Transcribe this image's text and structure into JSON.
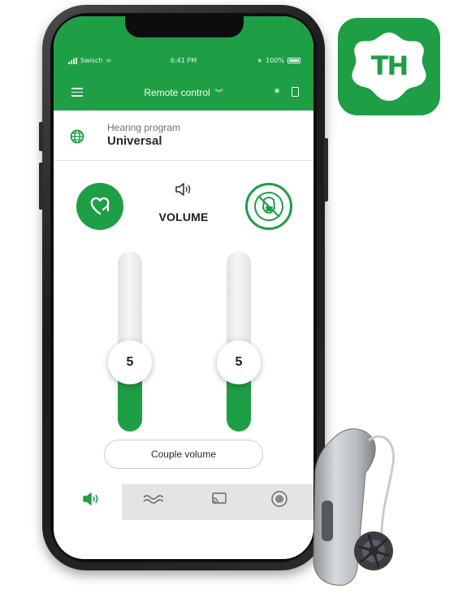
{
  "colors": {
    "accent": "#1e9e45",
    "track": "#e8e8e8",
    "text": "#222222"
  },
  "status_bar": {
    "carrier": "Swisch",
    "time": "6:41 PM",
    "battery_text": "100%"
  },
  "nav": {
    "title": "Remote control",
    "menu_icon": "hamburger-icon",
    "bluetooth_icon": "bluetooth-icon",
    "battery_icon": "battery-icon"
  },
  "program": {
    "label": "Hearing program",
    "value": "Universal",
    "icon": "globe-icon"
  },
  "volume": {
    "title": "VOLUME",
    "left": {
      "value": "5",
      "level": 0.3
    },
    "right": {
      "value": "5",
      "level": 0.3
    },
    "couple_label": "Couple volume",
    "left_action_icon": "heart-arrow-icon",
    "right_action_icon": "mute-face-icon"
  },
  "tabs": [
    {
      "icon": "speaker-icon",
      "active": true
    },
    {
      "icon": "wave-icon",
      "active": false
    },
    {
      "icon": "cast-icon",
      "active": false
    },
    {
      "icon": "record-icon",
      "active": false
    }
  ],
  "logo": {
    "text": "TH",
    "mark": "®"
  }
}
